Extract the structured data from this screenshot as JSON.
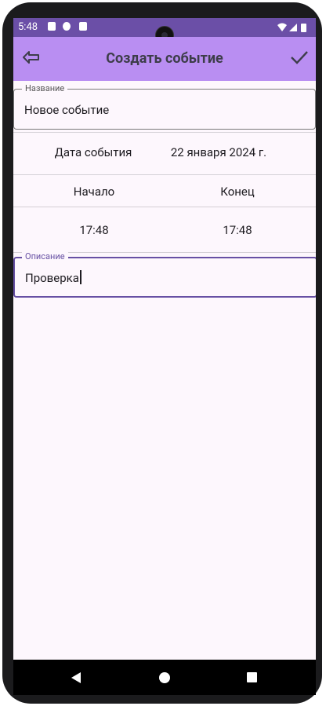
{
  "status_bar": {
    "time": "5:48"
  },
  "app_bar": {
    "title": "Создать событие",
    "back_icon": "arrow-left-icon",
    "save_icon": "check-icon"
  },
  "form": {
    "name_label": "Название",
    "name_value": "Новое событие",
    "date_label": "Дата события",
    "date_value": "22 января 2024 г.",
    "start_label": "Начало",
    "end_label": "Конец",
    "start_time": "17:48",
    "end_time": "17:48",
    "description_label": "Описание",
    "description_value": "Проверка"
  },
  "colors": {
    "accent": "#6750a4",
    "app_bar": "#b98ef2",
    "status_bar": "#6b4fa7",
    "background": "#fdf7fd"
  }
}
